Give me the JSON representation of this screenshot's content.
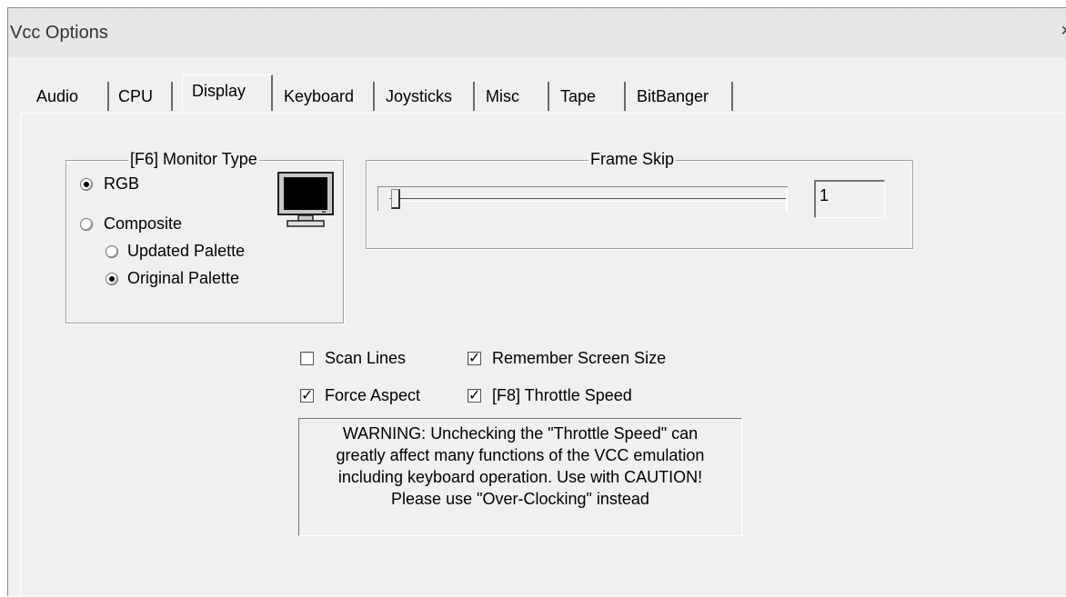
{
  "window": {
    "title": "Vcc Options",
    "close_glyph": "×"
  },
  "tabs": [
    {
      "label": "Audio"
    },
    {
      "label": "CPU"
    },
    {
      "label": "Display"
    },
    {
      "label": "Keyboard"
    },
    {
      "label": "Joysticks"
    },
    {
      "label": "Misc"
    },
    {
      "label": "Tape"
    },
    {
      "label": "BitBanger"
    }
  ],
  "monitor_type": {
    "legend": "[F6] Monitor Type",
    "rgb": "RGB",
    "composite": "Composite",
    "updated_palette": "Updated Palette",
    "original_palette": "Original Palette",
    "selected": "RGB",
    "palette_selected": "Original Palette",
    "icon": "monitor-icon"
  },
  "frame_skip": {
    "legend": "Frame Skip",
    "value": "1",
    "slider_value": 1
  },
  "options": {
    "scan_lines": {
      "label": "Scan Lines",
      "checked": false
    },
    "remember_screen_size": {
      "label": "Remember Screen Size",
      "checked": true
    },
    "force_aspect": {
      "label": "Force Aspect",
      "checked": true
    },
    "throttle_speed": {
      "label": "[F8] Throttle Speed",
      "checked": true
    }
  },
  "warning": {
    "line1": "WARNING: Unchecking the \"Throttle Speed\" can",
    "line2": "greatly affect many functions of the VCC emulation",
    "line3": "including keyboard operation. Use with CAUTION!",
    "line4": "Please use \"Over-Clocking\" instead"
  }
}
